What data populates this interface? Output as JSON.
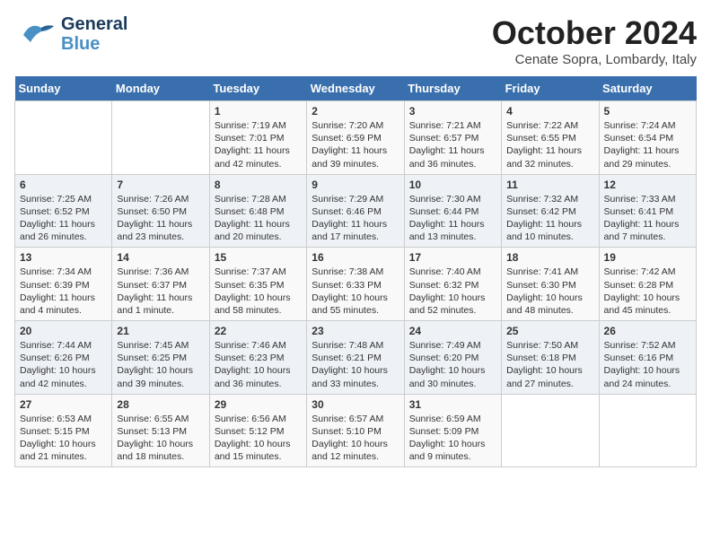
{
  "logo": {
    "line1": "General",
    "line2": "Blue"
  },
  "title": "October 2024",
  "location": "Cenate Sopra, Lombardy, Italy",
  "days_of_week": [
    "Sunday",
    "Monday",
    "Tuesday",
    "Wednesday",
    "Thursday",
    "Friday",
    "Saturday"
  ],
  "weeks": [
    [
      {
        "day": "",
        "sunrise": "",
        "sunset": "",
        "daylight": ""
      },
      {
        "day": "",
        "sunrise": "",
        "sunset": "",
        "daylight": ""
      },
      {
        "day": "1",
        "sunrise": "Sunrise: 7:19 AM",
        "sunset": "Sunset: 7:01 PM",
        "daylight": "Daylight: 11 hours and 42 minutes."
      },
      {
        "day": "2",
        "sunrise": "Sunrise: 7:20 AM",
        "sunset": "Sunset: 6:59 PM",
        "daylight": "Daylight: 11 hours and 39 minutes."
      },
      {
        "day": "3",
        "sunrise": "Sunrise: 7:21 AM",
        "sunset": "Sunset: 6:57 PM",
        "daylight": "Daylight: 11 hours and 36 minutes."
      },
      {
        "day": "4",
        "sunrise": "Sunrise: 7:22 AM",
        "sunset": "Sunset: 6:55 PM",
        "daylight": "Daylight: 11 hours and 32 minutes."
      },
      {
        "day": "5",
        "sunrise": "Sunrise: 7:24 AM",
        "sunset": "Sunset: 6:54 PM",
        "daylight": "Daylight: 11 hours and 29 minutes."
      }
    ],
    [
      {
        "day": "6",
        "sunrise": "Sunrise: 7:25 AM",
        "sunset": "Sunset: 6:52 PM",
        "daylight": "Daylight: 11 hours and 26 minutes."
      },
      {
        "day": "7",
        "sunrise": "Sunrise: 7:26 AM",
        "sunset": "Sunset: 6:50 PM",
        "daylight": "Daylight: 11 hours and 23 minutes."
      },
      {
        "day": "8",
        "sunrise": "Sunrise: 7:28 AM",
        "sunset": "Sunset: 6:48 PM",
        "daylight": "Daylight: 11 hours and 20 minutes."
      },
      {
        "day": "9",
        "sunrise": "Sunrise: 7:29 AM",
        "sunset": "Sunset: 6:46 PM",
        "daylight": "Daylight: 11 hours and 17 minutes."
      },
      {
        "day": "10",
        "sunrise": "Sunrise: 7:30 AM",
        "sunset": "Sunset: 6:44 PM",
        "daylight": "Daylight: 11 hours and 13 minutes."
      },
      {
        "day": "11",
        "sunrise": "Sunrise: 7:32 AM",
        "sunset": "Sunset: 6:42 PM",
        "daylight": "Daylight: 11 hours and 10 minutes."
      },
      {
        "day": "12",
        "sunrise": "Sunrise: 7:33 AM",
        "sunset": "Sunset: 6:41 PM",
        "daylight": "Daylight: 11 hours and 7 minutes."
      }
    ],
    [
      {
        "day": "13",
        "sunrise": "Sunrise: 7:34 AM",
        "sunset": "Sunset: 6:39 PM",
        "daylight": "Daylight: 11 hours and 4 minutes."
      },
      {
        "day": "14",
        "sunrise": "Sunrise: 7:36 AM",
        "sunset": "Sunset: 6:37 PM",
        "daylight": "Daylight: 11 hours and 1 minute."
      },
      {
        "day": "15",
        "sunrise": "Sunrise: 7:37 AM",
        "sunset": "Sunset: 6:35 PM",
        "daylight": "Daylight: 10 hours and 58 minutes."
      },
      {
        "day": "16",
        "sunrise": "Sunrise: 7:38 AM",
        "sunset": "Sunset: 6:33 PM",
        "daylight": "Daylight: 10 hours and 55 minutes."
      },
      {
        "day": "17",
        "sunrise": "Sunrise: 7:40 AM",
        "sunset": "Sunset: 6:32 PM",
        "daylight": "Daylight: 10 hours and 52 minutes."
      },
      {
        "day": "18",
        "sunrise": "Sunrise: 7:41 AM",
        "sunset": "Sunset: 6:30 PM",
        "daylight": "Daylight: 10 hours and 48 minutes."
      },
      {
        "day": "19",
        "sunrise": "Sunrise: 7:42 AM",
        "sunset": "Sunset: 6:28 PM",
        "daylight": "Daylight: 10 hours and 45 minutes."
      }
    ],
    [
      {
        "day": "20",
        "sunrise": "Sunrise: 7:44 AM",
        "sunset": "Sunset: 6:26 PM",
        "daylight": "Daylight: 10 hours and 42 minutes."
      },
      {
        "day": "21",
        "sunrise": "Sunrise: 7:45 AM",
        "sunset": "Sunset: 6:25 PM",
        "daylight": "Daylight: 10 hours and 39 minutes."
      },
      {
        "day": "22",
        "sunrise": "Sunrise: 7:46 AM",
        "sunset": "Sunset: 6:23 PM",
        "daylight": "Daylight: 10 hours and 36 minutes."
      },
      {
        "day": "23",
        "sunrise": "Sunrise: 7:48 AM",
        "sunset": "Sunset: 6:21 PM",
        "daylight": "Daylight: 10 hours and 33 minutes."
      },
      {
        "day": "24",
        "sunrise": "Sunrise: 7:49 AM",
        "sunset": "Sunset: 6:20 PM",
        "daylight": "Daylight: 10 hours and 30 minutes."
      },
      {
        "day": "25",
        "sunrise": "Sunrise: 7:50 AM",
        "sunset": "Sunset: 6:18 PM",
        "daylight": "Daylight: 10 hours and 27 minutes."
      },
      {
        "day": "26",
        "sunrise": "Sunrise: 7:52 AM",
        "sunset": "Sunset: 6:16 PM",
        "daylight": "Daylight: 10 hours and 24 minutes."
      }
    ],
    [
      {
        "day": "27",
        "sunrise": "Sunrise: 6:53 AM",
        "sunset": "Sunset: 5:15 PM",
        "daylight": "Daylight: 10 hours and 21 minutes."
      },
      {
        "day": "28",
        "sunrise": "Sunrise: 6:55 AM",
        "sunset": "Sunset: 5:13 PM",
        "daylight": "Daylight: 10 hours and 18 minutes."
      },
      {
        "day": "29",
        "sunrise": "Sunrise: 6:56 AM",
        "sunset": "Sunset: 5:12 PM",
        "daylight": "Daylight: 10 hours and 15 minutes."
      },
      {
        "day": "30",
        "sunrise": "Sunrise: 6:57 AM",
        "sunset": "Sunset: 5:10 PM",
        "daylight": "Daylight: 10 hours and 12 minutes."
      },
      {
        "day": "31",
        "sunrise": "Sunrise: 6:59 AM",
        "sunset": "Sunset: 5:09 PM",
        "daylight": "Daylight: 10 hours and 9 minutes."
      },
      {
        "day": "",
        "sunrise": "",
        "sunset": "",
        "daylight": ""
      },
      {
        "day": "",
        "sunrise": "",
        "sunset": "",
        "daylight": ""
      }
    ]
  ]
}
